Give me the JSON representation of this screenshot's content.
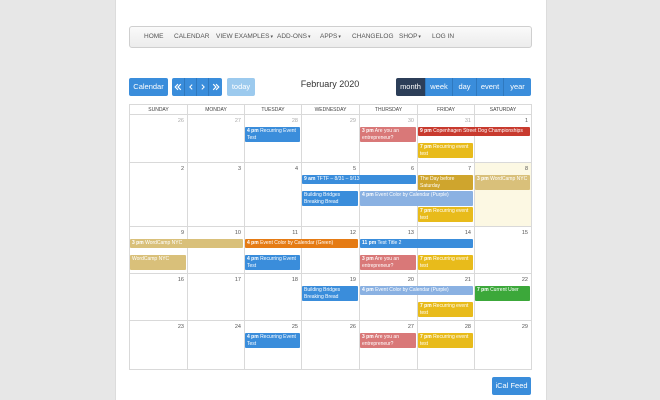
{
  "nav": {
    "items": [
      {
        "label": "HOME",
        "dropdown": false
      },
      {
        "label": "CALENDAR",
        "dropdown": false
      },
      {
        "label": "VIEW EXAMPLES",
        "dropdown": true
      },
      {
        "label": "ADD-ONS",
        "dropdown": true
      },
      {
        "label": "APPS",
        "dropdown": true
      },
      {
        "label": "CHANGELOG",
        "dropdown": false
      },
      {
        "label": "SHOP",
        "dropdown": true
      },
      {
        "label": "LOG IN",
        "dropdown": false
      }
    ]
  },
  "toolbar": {
    "calendar_label": "Calendar",
    "today_label": "today",
    "title": "February 2020",
    "views": [
      {
        "label": "month",
        "active": true
      },
      {
        "label": "week",
        "active": false
      },
      {
        "label": "day",
        "active": false
      },
      {
        "label": "event",
        "active": false
      },
      {
        "label": "year",
        "active": false
      }
    ]
  },
  "weekdays": [
    "SUNDAY",
    "MONDAY",
    "TUESDAY",
    "WEDNESDAY",
    "THURSDAY",
    "FRIDAY",
    "SATURDAY"
  ],
  "weeks": [
    {
      "days": [
        {
          "num": "26",
          "other": true
        },
        {
          "num": "27",
          "other": true
        },
        {
          "num": "28",
          "other": true
        },
        {
          "num": "29",
          "other": true
        },
        {
          "num": "30",
          "other": true
        },
        {
          "num": "31",
          "other": true
        },
        {
          "num": "1",
          "other": false
        }
      ]
    },
    {
      "days": [
        {
          "num": "2"
        },
        {
          "num": "3"
        },
        {
          "num": "4"
        },
        {
          "num": "5"
        },
        {
          "num": "6"
        },
        {
          "num": "7"
        },
        {
          "num": "8",
          "today": true
        }
      ]
    },
    {
      "days": [
        {
          "num": "9"
        },
        {
          "num": "10"
        },
        {
          "num": "11"
        },
        {
          "num": "12"
        },
        {
          "num": "13"
        },
        {
          "num": "14"
        },
        {
          "num": "15"
        }
      ]
    },
    {
      "days": [
        {
          "num": "16"
        },
        {
          "num": "17"
        },
        {
          "num": "18"
        },
        {
          "num": "19"
        },
        {
          "num": "20"
        },
        {
          "num": "21"
        },
        {
          "num": "22"
        }
      ]
    },
    {
      "days": [
        {
          "num": "23"
        },
        {
          "num": "24"
        },
        {
          "num": "25"
        },
        {
          "num": "26"
        },
        {
          "num": "27"
        },
        {
          "num": "28"
        },
        {
          "num": "29"
        }
      ]
    }
  ],
  "events": [
    {
      "week": 0,
      "start": 2,
      "span": 1,
      "slot": 0,
      "time": "4 pm",
      "title": "Recurring Event Test",
      "color": "blue"
    },
    {
      "week": 0,
      "start": 4,
      "span": 1,
      "slot": 0,
      "time": "3 pm",
      "title": "Are you an entrepreneur?",
      "color": "pink"
    },
    {
      "week": 0,
      "start": 5,
      "span": 2,
      "slot": 0,
      "time": "9 pm",
      "title": "Copenhagen Street Dog Championships",
      "color": "red"
    },
    {
      "week": 0,
      "start": 5,
      "span": 1,
      "slot": 1,
      "time": "7 pm",
      "title": "Recurring event test",
      "color": "yellow"
    },
    {
      "week": 1,
      "start": 3,
      "span": 2,
      "slot": 0,
      "time": "9 am",
      "title": "TFTF – 8/31 – 9/13",
      "color": "blue"
    },
    {
      "week": 1,
      "start": 5,
      "span": 1,
      "slot": 0,
      "time": "",
      "title": "The Day before Saturday",
      "color": "gold"
    },
    {
      "week": 1,
      "start": 6,
      "span": 1,
      "slot": 0,
      "time": "3 pm",
      "title": "WordCamp NYC",
      "color": "tan"
    },
    {
      "week": 1,
      "start": 3,
      "span": 1,
      "slot": 1,
      "time": "",
      "title": "Building Bridges Breaking Bread",
      "color": "blue"
    },
    {
      "week": 1,
      "start": 4,
      "span": 2,
      "slot": 1,
      "time": "4 pm",
      "title": "Event Color by Calendar (Purple)",
      "color": "purple"
    },
    {
      "week": 1,
      "start": 5,
      "span": 1,
      "slot": 2,
      "time": "7 pm",
      "title": "Recurring event test",
      "color": "yellow"
    },
    {
      "week": 2,
      "start": 0,
      "span": 2,
      "slot": 0,
      "time": "3 pm",
      "title": "WordCamp NYC",
      "color": "tan"
    },
    {
      "week": 2,
      "start": 2,
      "span": 2,
      "slot": 0,
      "time": "4 pm",
      "title": "Event Color by Calendar (Green)",
      "color": "orange"
    },
    {
      "week": 2,
      "start": 4,
      "span": 2,
      "slot": 0,
      "time": "11 pm",
      "title": "Test Title 2",
      "color": "blue"
    },
    {
      "week": 2,
      "start": 0,
      "span": 1,
      "slot": 1,
      "time": "",
      "title": "WordCamp NYC",
      "color": "tan"
    },
    {
      "week": 2,
      "start": 2,
      "span": 1,
      "slot": 1,
      "time": "4 pm",
      "title": "Recurring Event Test",
      "color": "blue"
    },
    {
      "week": 2,
      "start": 4,
      "span": 1,
      "slot": 1,
      "time": "3 pm",
      "title": "Are you an entrepreneur?",
      "color": "pink"
    },
    {
      "week": 2,
      "start": 5,
      "span": 1,
      "slot": 1,
      "time": "7 pm",
      "title": "Recurring event test",
      "color": "yellow"
    },
    {
      "week": 3,
      "start": 3,
      "span": 1,
      "slot": 0,
      "time": "",
      "title": "Building Bridges Breaking Bread",
      "color": "blue"
    },
    {
      "week": 3,
      "start": 4,
      "span": 2,
      "slot": 0,
      "time": "4 pm",
      "title": "Event Color by Calendar (Purple)",
      "color": "purple"
    },
    {
      "week": 3,
      "start": 6,
      "span": 1,
      "slot": 0,
      "time": "7 pm",
      "title": "Current User",
      "color": "green"
    },
    {
      "week": 3,
      "start": 5,
      "span": 1,
      "slot": 1,
      "time": "7 pm",
      "title": "Recurring event test",
      "color": "yellow"
    },
    {
      "week": 4,
      "start": 2,
      "span": 1,
      "slot": 0,
      "time": "4 pm",
      "title": "Recurring Event Test",
      "color": "blue"
    },
    {
      "week": 4,
      "start": 4,
      "span": 1,
      "slot": 0,
      "time": "3 pm",
      "title": "Are you an entrepreneur?",
      "color": "pink"
    },
    {
      "week": 4,
      "start": 5,
      "span": 1,
      "slot": 0,
      "time": "7 pm",
      "title": "Recurring event test",
      "color": "yellow"
    }
  ],
  "footer": {
    "ical_label": "iCal Feed"
  },
  "colors": {
    "primary": "#3a8ddb",
    "active": "#2c3e58",
    "today_bg": "#fcf8e3"
  }
}
